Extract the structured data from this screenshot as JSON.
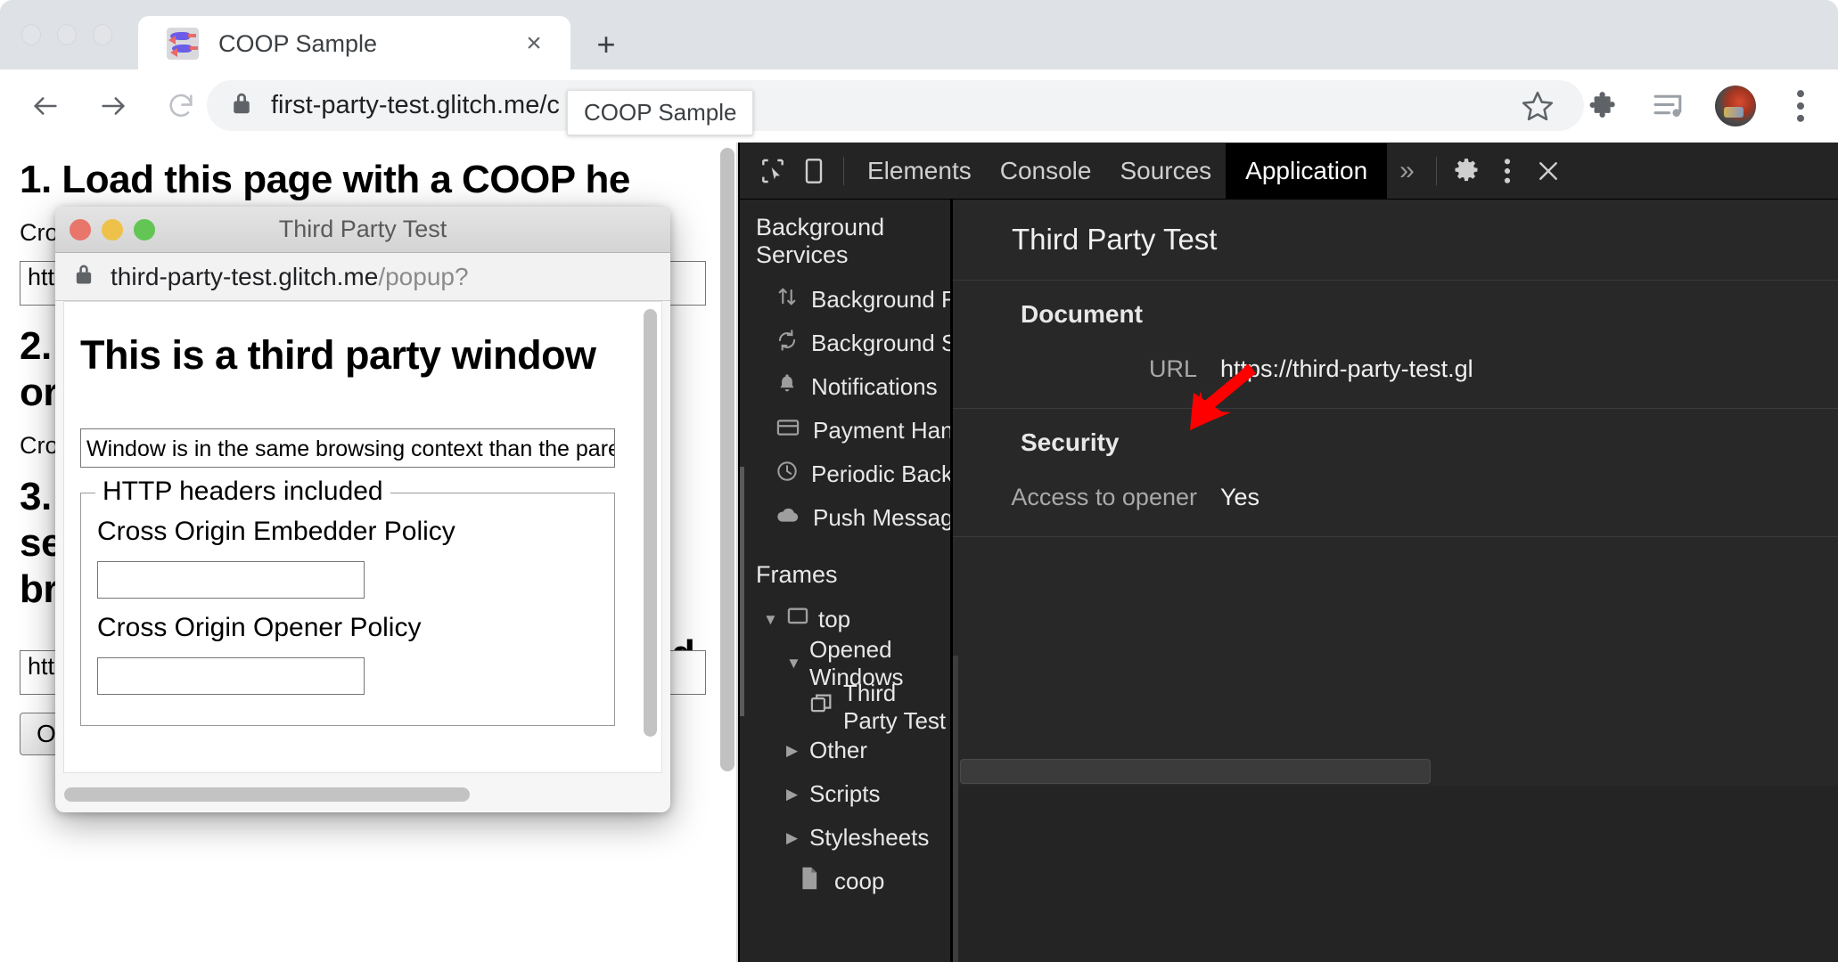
{
  "browser": {
    "window_controls": [
      "close",
      "minimize",
      "maximize"
    ],
    "tab": {
      "title": "COOP Sample",
      "favicon_name": "fish-favicon",
      "close_label": "×"
    },
    "new_tab_label": "+",
    "toolbar": {
      "back_label": "←",
      "forward_label": "→",
      "reload_label": "⟳",
      "url": "first-party-test.glitch.me/c",
      "lock_icon": "lock-icon",
      "star_icon": "star-icon",
      "extensions_icon": "puzzle-icon",
      "media_icon": "media-list-icon",
      "avatar_icon": "profile-avatar",
      "menu_icon": "three-dot-menu-icon"
    },
    "url_tooltip": "COOP Sample"
  },
  "page": {
    "heading1": "1. Load this page with a COOP he",
    "para1": "Cro",
    "input1_value": "http",
    "heading2_line1": "2.",
    "heading2_line2": "or",
    "para2": "Cro",
    "heading3_line1": "3.",
    "heading3_line2": "se",
    "heading3_line3": "br",
    "heading3_fragment_right": "d",
    "popup_url_value": "https://third-party-test.glitch.me/popup?",
    "open_popup_button": "Open a popup"
  },
  "popup_window": {
    "title": "Third Party Test",
    "url_main": "third-party-test.glitch.me",
    "url_path": "/popup?",
    "lock_icon": "lock-icon",
    "heading": "This is a third party window",
    "status_field_value": "Window is in the same browsing context than the pare",
    "fieldset_legend": "HTTP headers included",
    "coep_label": "Cross Origin Embedder Policy",
    "coep_value": "",
    "coop_label": "Cross Origin Opener Policy",
    "coop_value": ""
  },
  "devtools": {
    "toolbar": {
      "inspect_icon": "inspect-element-icon",
      "device_icon": "device-toolbar-icon",
      "tabs": [
        {
          "label": "Elements",
          "active": false
        },
        {
          "label": "Console",
          "active": false
        },
        {
          "label": "Sources",
          "active": false
        },
        {
          "label": "Application",
          "active": true
        }
      ],
      "more_tabs_label": "»",
      "settings_icon": "gear-icon",
      "kebab_icon": "three-dot-menu-icon",
      "close_icon": "close-icon"
    },
    "sidebar": {
      "background_services": {
        "title": "Background Services",
        "items": [
          {
            "label": "Background Fetch",
            "icon": "background-fetch-icon"
          },
          {
            "label": "Background Sync",
            "icon": "background-sync-icon"
          },
          {
            "label": "Notifications",
            "icon": "bell-icon"
          },
          {
            "label": "Payment Handler",
            "icon": "credit-card-icon"
          },
          {
            "label": "Periodic Background Sync",
            "icon": "clock-icon"
          },
          {
            "label": "Push Messaging",
            "icon": "cloud-icon"
          }
        ]
      },
      "frames": {
        "title": "Frames",
        "tree": [
          {
            "label": "top",
            "icon": "frame-icon",
            "expanded": true,
            "depth": 0,
            "selected": false
          },
          {
            "label": "Opened Windows",
            "icon": "none",
            "expanded": true,
            "depth": 1,
            "selected": false
          },
          {
            "label": "Third Party Test",
            "icon": "window-icon",
            "expanded": null,
            "depth": 2,
            "selected": true
          },
          {
            "label": "Other",
            "icon": "none",
            "expanded": false,
            "depth": 1,
            "selected": false
          },
          {
            "label": "Scripts",
            "icon": "none",
            "expanded": false,
            "depth": 1,
            "selected": false
          },
          {
            "label": "Stylesheets",
            "icon": "none",
            "expanded": false,
            "depth": 1,
            "selected": false
          },
          {
            "label": "coop",
            "icon": "document-icon",
            "expanded": null,
            "depth": 2,
            "selected": false
          }
        ]
      }
    },
    "panel": {
      "title": "Third Party Test",
      "groups": [
        {
          "heading": "Document",
          "rows": [
            {
              "key": "URL",
              "value": "https://third-party-test.gl"
            }
          ]
        },
        {
          "heading": "Security",
          "rows": [
            {
              "key": "Access to opener",
              "value": "Yes"
            }
          ]
        }
      ],
      "annotation": {
        "name": "red-arrow-annotation",
        "color": "#ff0000"
      }
    }
  },
  "colors": {
    "devtools_bg": "#242424",
    "devtools_panel_bg": "#282828",
    "selected_row": "#454545",
    "active_tab_bg": "#000000",
    "annotation_red": "#ff0000",
    "chrome_tabstrip": "#dee1e6",
    "omnibox_bg": "#f1f3f4"
  }
}
